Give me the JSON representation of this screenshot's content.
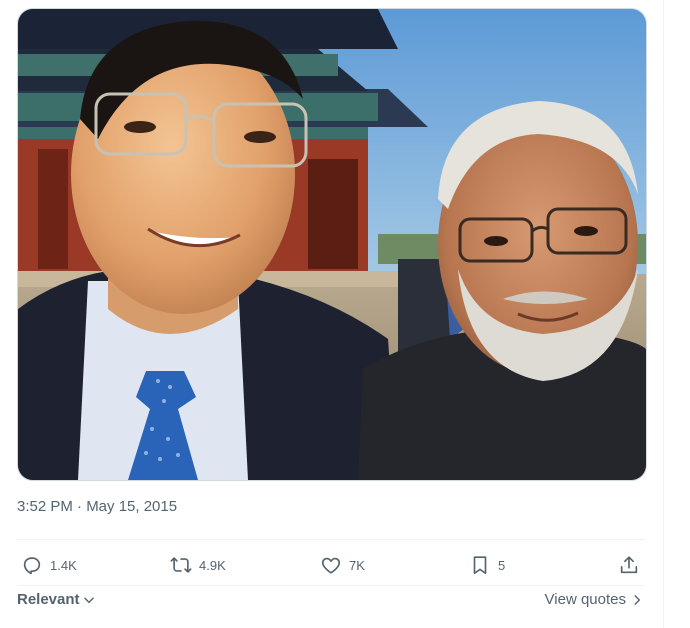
{
  "tweet": {
    "photo_alt": "Image",
    "timestamp": "3:52 PM · May 15, 2015"
  },
  "actions": {
    "replies": {
      "icon": "reply-icon",
      "count": "1.4K"
    },
    "reposts": {
      "icon": "repost-icon",
      "count": "4.9K"
    },
    "likes": {
      "icon": "heart-icon",
      "count": "7K"
    },
    "bookmarks": {
      "icon": "bookmark-icon",
      "count": "5"
    },
    "share": {
      "icon": "share-icon"
    }
  },
  "replies_sort": {
    "label": "Relevant",
    "icon": "chevron-down-icon"
  },
  "quotes_link": {
    "label": "View quotes",
    "icon": "chevron-right-icon"
  },
  "colors": {
    "text_secondary": "#536471",
    "divider": "#eff3f4",
    "image_border": "#cfd9de"
  }
}
